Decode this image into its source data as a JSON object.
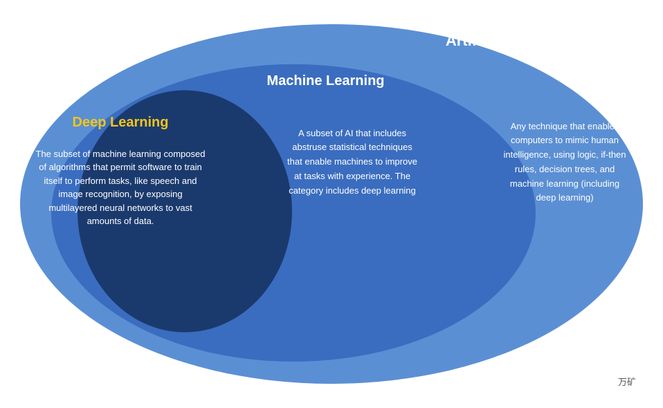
{
  "diagram": {
    "title_ai": "Artificial Intelligence",
    "title_ml": "Machine Learning",
    "title_dl": "Deep Learning",
    "text_dl": "The subset of machine learning composed of algorithms that permit software to train itself to perform tasks, like speech and image recognition, by exposing multilayered neural networks to vast amounts of data.",
    "text_ml": "A subset of AI that includes abstruse statistical techniques that enable machines to improve at tasks with experience. The category includes deep learning",
    "text_ai": "Any technique that enables computers to mimic human intelligence, using logic, if-then rules, decision trees, and machine learning (including deep learning)",
    "watermark": "万矿"
  }
}
